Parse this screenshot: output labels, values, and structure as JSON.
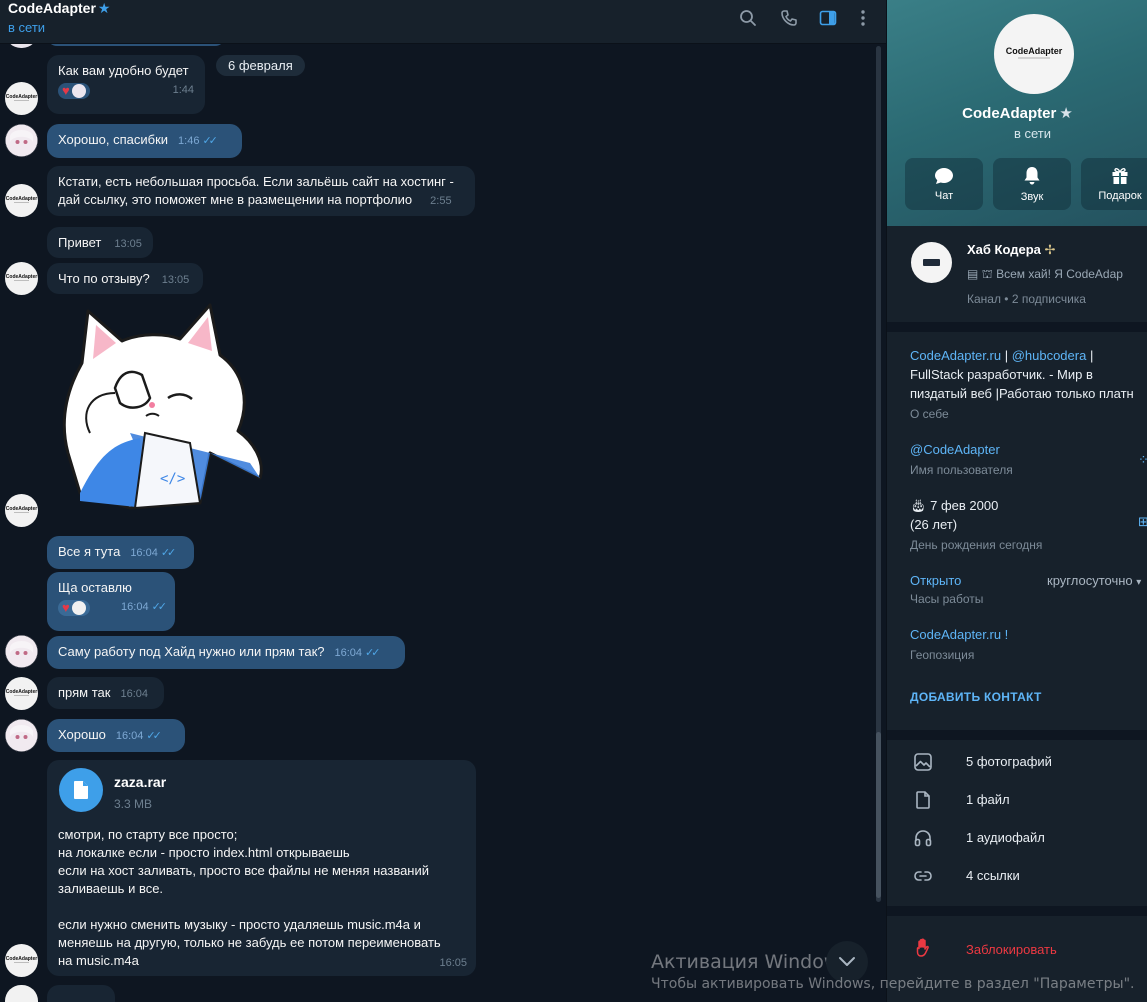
{
  "colors": {
    "accent": "#3e9fe9",
    "bg": "#0e1621",
    "incoming": "#182533",
    "outgoing": "#2b5278",
    "danger": "#ec3942"
  },
  "header": {
    "title": "CodeAdapter",
    "status": "в сети",
    "icons": [
      "search-icon",
      "phone-icon",
      "sidebar-toggle-icon",
      "more-vertical-icon"
    ]
  },
  "date_separator": "6 февраля",
  "messages": [
    {
      "text": "Как вам удобно будет",
      "time": "1:44",
      "direction": "in",
      "reactions": [
        "heart",
        "avatar"
      ]
    },
    {
      "text": "Хорошо, спасибки",
      "time": "1:46",
      "direction": "out"
    },
    {
      "text_line1": "Кстати, есть небольшая просьба. Если зальёшь сайт на хостинг -",
      "text_line2": "дай ссылку, это поможет мне в размещении на портфолио",
      "time": "2:55",
      "direction": "in"
    },
    {
      "text": "Привет",
      "time": "13:05",
      "direction": "in"
    },
    {
      "text": "Что по отзыву?",
      "time": "13:05",
      "direction": "in"
    },
    {
      "type": "sticker",
      "sticker": "white-cat-facepalm"
    },
    {
      "text": "Все я тута",
      "time": "16:04",
      "direction": "out"
    },
    {
      "text": "Ща оставлю",
      "time": "16:04",
      "direction": "out",
      "reactions": [
        "heart",
        "avatar"
      ]
    },
    {
      "text": "Саму работу под Хайд нужно или прям так?",
      "time": "16:04",
      "direction": "out"
    },
    {
      "text": "прям так",
      "time": "16:04",
      "direction": "in"
    },
    {
      "text": "Хорошо",
      "time": "16:04",
      "direction": "out"
    },
    {
      "direction": "in",
      "file_name": "zaza.rar",
      "file_size": "3.3 MB",
      "lines": [
        "смотри, по старту все просто;",
        "на локалке если - просто index.html открываешь",
        "если на хост заливать, просто все файлы не меняя названий",
        "заливаешь и все.",
        "",
        "если нужно сменить музыку - просто удаляешь music.m4a и",
        "меняешь на другую, только не забудь ее потом переименовать",
        "на music.m4a"
      ],
      "time": "16:05"
    }
  ],
  "avatar_text": "CodeAdapter",
  "watermark": {
    "title": "Активация Windows",
    "subtitle": "Чтобы активировать Windows, перейдите в раздел \"Параметры\"."
  },
  "profile": {
    "name": "CodeAdapter",
    "status": "в сети",
    "buttons": [
      {
        "label": "Чат",
        "icon": "chat-bubble-icon"
      },
      {
        "label": "Звук",
        "icon": "bell-icon"
      },
      {
        "label": "Подарок",
        "icon": "gift-icon"
      }
    ],
    "channel": {
      "name": "Хаб Кодера",
      "preview": "Всем хай! Я CodeAdap",
      "subscribers": "Канал • 2 подписчика"
    },
    "about": {
      "line1_link1": "CodeAdapter.ru",
      "line1_sep1": " | ",
      "line1_link2": "@hubcodera",
      "line1_sep2": " |",
      "line2": "FullStack разработчик. - Мир в",
      "line3": "пиздатый веб |Работаю только платн",
      "label": "О себе"
    },
    "username": {
      "value": "@CodeAdapter",
      "label": "Имя пользователя"
    },
    "birthday": {
      "date": "7 фев 2000",
      "age": "(26 лет)",
      "label": "День рождения сегодня"
    },
    "hours": {
      "status": "Открыто",
      "detail": "круглосуточно",
      "label": "Часы работы"
    },
    "location": {
      "value": "CodeAdapter.ru !",
      "label": "Геопозиция"
    },
    "add_contact": "ДОБАВИТЬ КОНТАКТ",
    "media": [
      {
        "label": "5 фотографий",
        "icon": "image-icon"
      },
      {
        "label": "1 файл",
        "icon": "file-icon"
      },
      {
        "label": "1 аудиофайл",
        "icon": "headphones-icon"
      },
      {
        "label": "4 ссылки",
        "icon": "link-icon"
      }
    ],
    "block": "Заблокировать"
  }
}
